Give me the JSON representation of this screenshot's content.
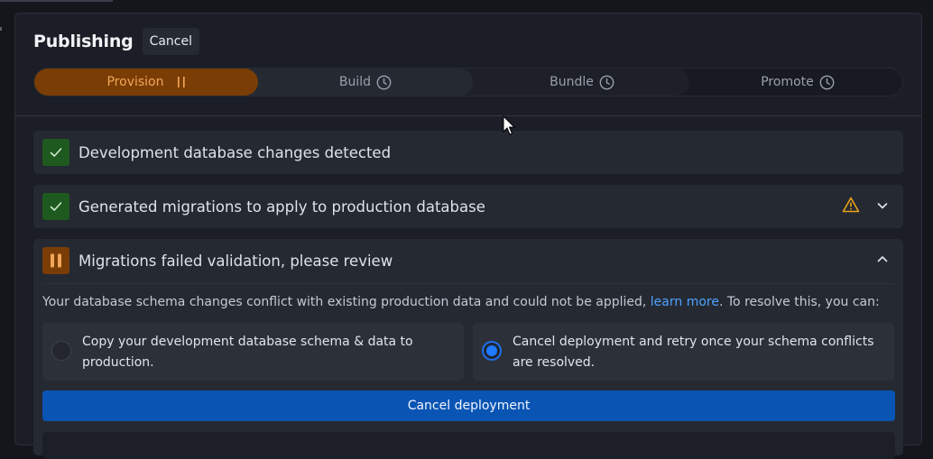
{
  "header": {
    "title": "Publishing",
    "cancel_label": "Cancel"
  },
  "stepper": {
    "steps": [
      {
        "label": "Provision",
        "state": "active",
        "icon": "pause-icon"
      },
      {
        "label": "Build",
        "state": "pending",
        "icon": "clock-icon"
      },
      {
        "label": "Bundle",
        "state": "pending",
        "icon": "clock-icon"
      },
      {
        "label": "Promote",
        "state": "pending",
        "icon": "clock-icon"
      }
    ]
  },
  "tasks": [
    {
      "label": "Development database changes detected",
      "status": "success",
      "icon": "check-icon"
    },
    {
      "label": "Generated migrations to apply to production database",
      "status": "success",
      "icon": "check-icon",
      "warning_icon": "warning-icon",
      "toggle_icon": "chevron-down-icon"
    },
    {
      "label": "Migrations failed validation, please review",
      "status": "paused",
      "icon": "pause-icon",
      "toggle_icon": "chevron-up-icon"
    }
  ],
  "review": {
    "message_before": "Your database schema changes conflict with existing production data and could not be applied, ",
    "link_text": "learn more",
    "message_after": ". To resolve this, you can:",
    "options": [
      {
        "label": "Copy your development database schema & data to production.",
        "selected": false
      },
      {
        "label": "Cancel deployment and retry once your schema conflicts are resolved.",
        "selected": true
      }
    ],
    "action_label": "Cancel deployment"
  },
  "colors": {
    "accent_orange": "#7a3d05",
    "accent_orange_text": "#f2a65a",
    "success_green": "#1e5a1f",
    "primary_blue": "#0a55b3",
    "link_blue": "#4da3ff",
    "warning_yellow": "#e8a317"
  }
}
